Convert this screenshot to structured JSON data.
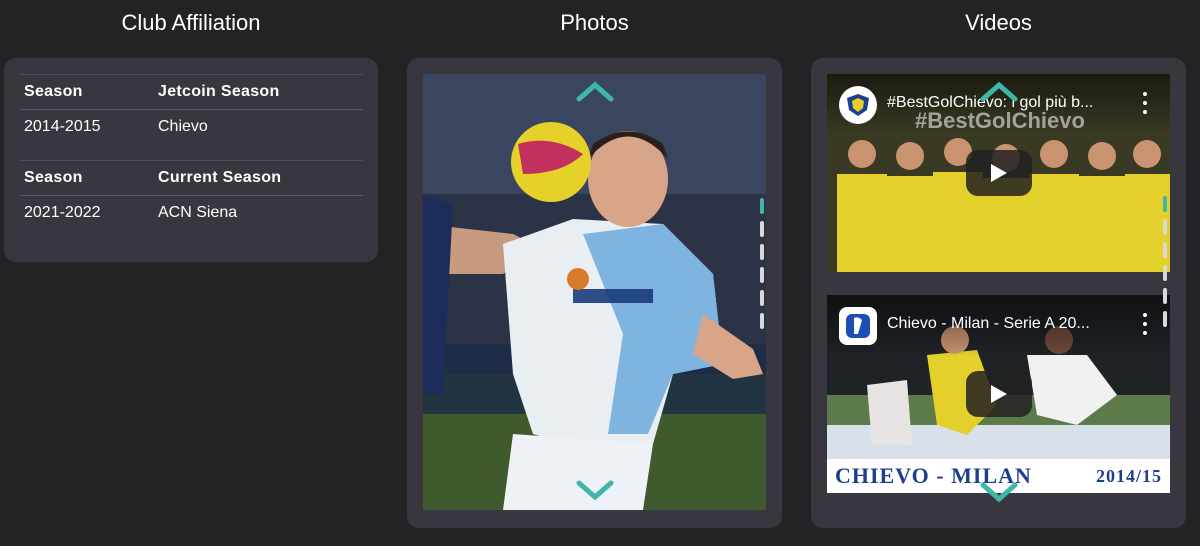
{
  "columns": {
    "club_title": "Club Affiliation",
    "photos_title": "Photos",
    "videos_title": "Videos"
  },
  "affiliation": [
    {
      "col1_header": "Season",
      "col2_header": "Jetcoin Season",
      "season": "2014-2015",
      "club": "Chievo"
    },
    {
      "col1_header": "Season",
      "col2_header": "Current Season",
      "season": "2021-2022",
      "club": "ACN Siena"
    }
  ],
  "photos": {
    "dots": 6,
    "active_dot": 0
  },
  "videos": {
    "items": [
      {
        "title": "#BestGolChievo: i gol più b...",
        "overlay": "#BestGolChievo",
        "caption": "",
        "caption_right": ""
      },
      {
        "title": "Chievo - Milan - Serie A 20...",
        "overlay": "",
        "caption": "CHIEVO - MILAN",
        "caption_right": "2014/15"
      }
    ]
  },
  "colors": {
    "background": "#232225",
    "panel": "#38373f",
    "accent": "#3fb6a6"
  },
  "icons": {
    "nav_up": "chevron-up-icon",
    "nav_down": "chevron-down-icon",
    "play": "play-icon",
    "more": "more-vertical-icon"
  }
}
